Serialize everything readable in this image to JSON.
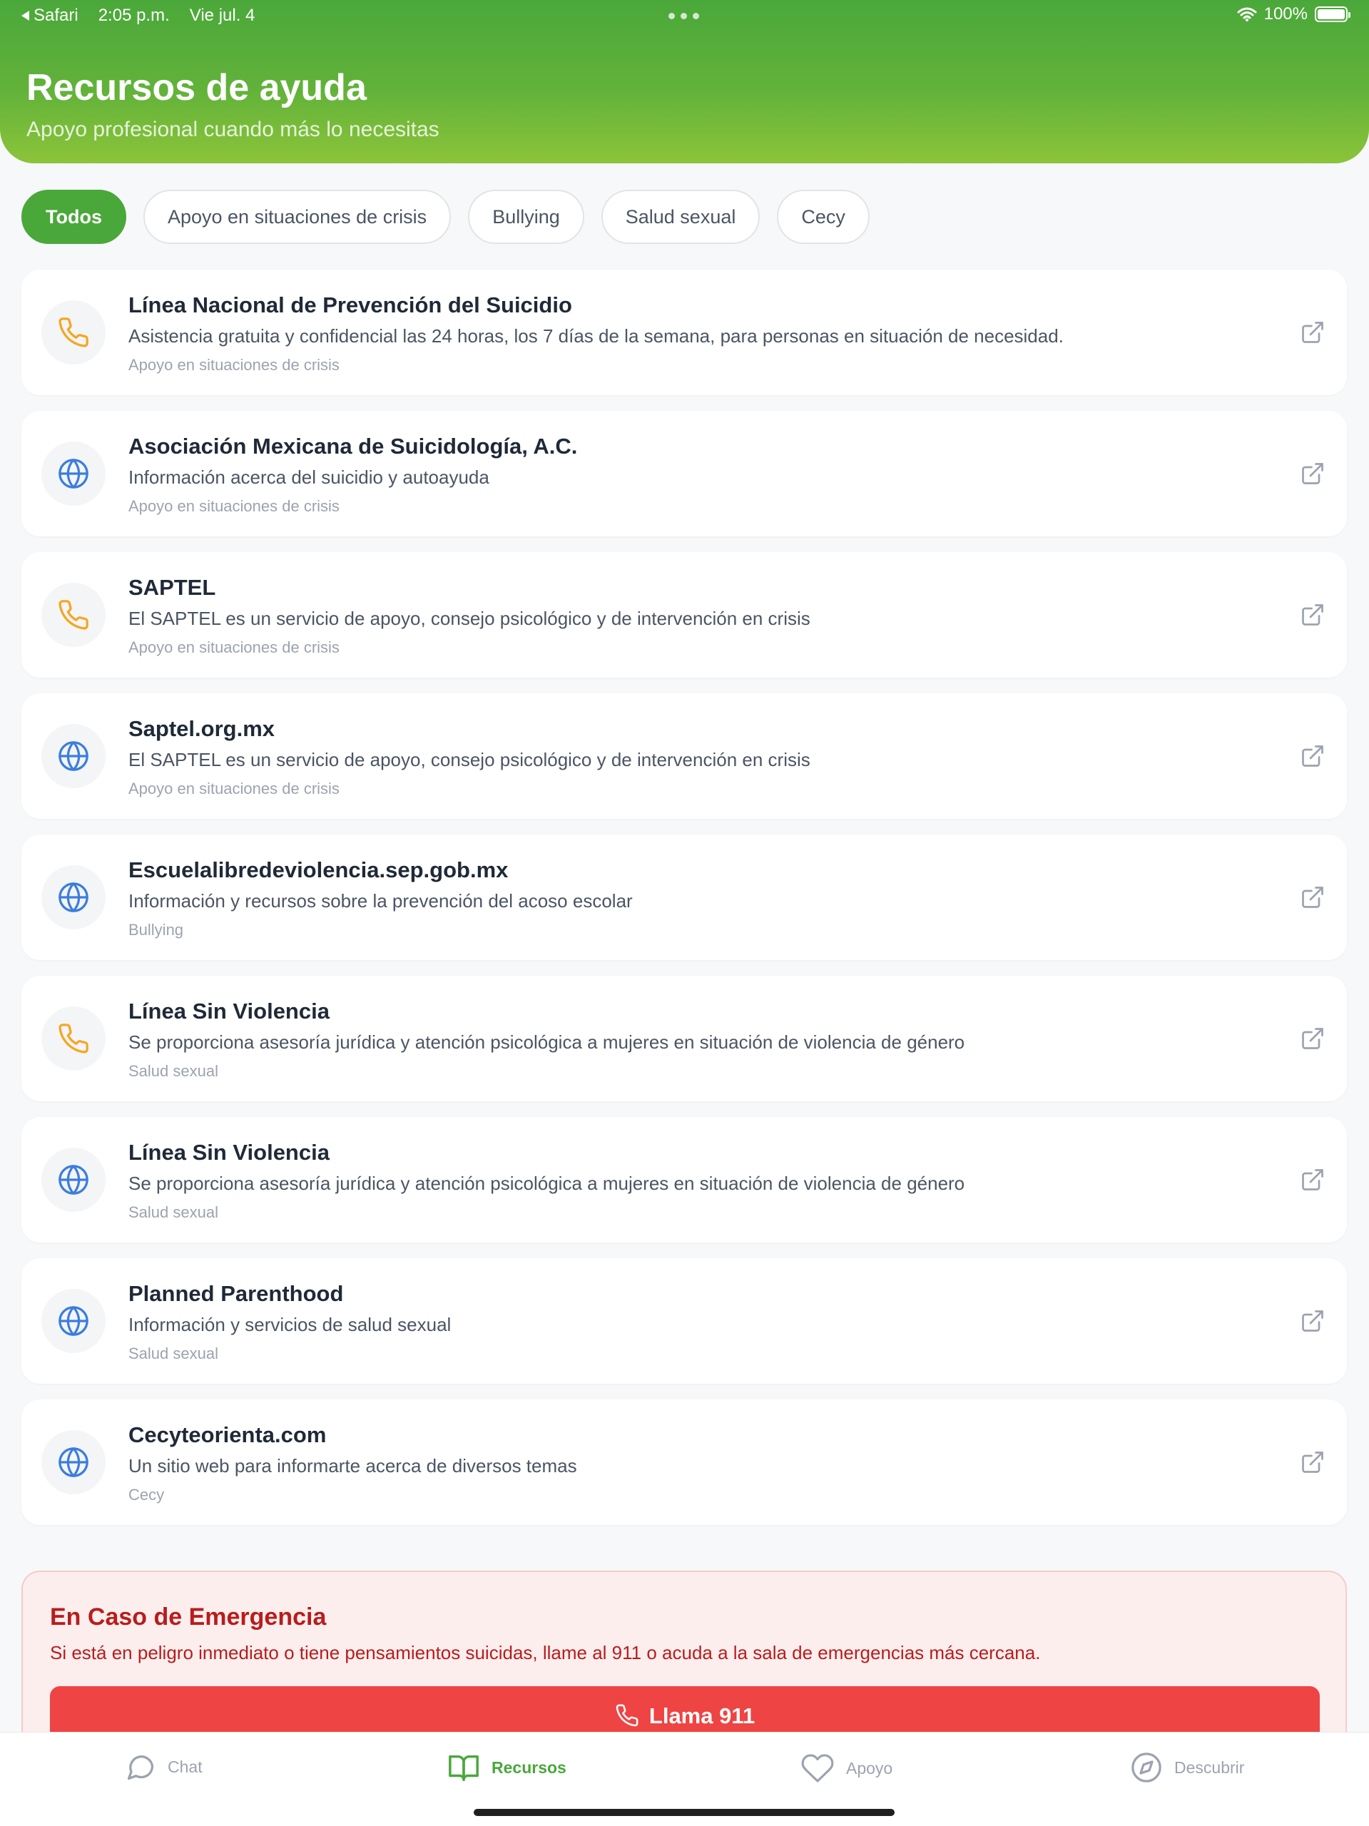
{
  "status_bar": {
    "back_app": "Safari",
    "time": "2:05 p.m.",
    "date": "Vie jul. 4",
    "battery": "100%"
  },
  "header": {
    "title": "Recursos de ayuda",
    "subtitle": "Apoyo profesional cuando más lo necesitas"
  },
  "filters": [
    {
      "label": "Todos",
      "active": true
    },
    {
      "label": "Apoyo en situaciones de crisis",
      "active": false
    },
    {
      "label": "Bullying",
      "active": false
    },
    {
      "label": "Salud sexual",
      "active": false
    },
    {
      "label": "Cecy",
      "active": false
    }
  ],
  "resources": [
    {
      "icon": "phone-icon",
      "name": "Línea Nacional de Prevención del Suicidio",
      "description": "Asistencia gratuita y confidencial las 24 horas, los 7 días de la semana, para personas en situación de necesidad.",
      "category": "Apoyo en situaciones de crisis"
    },
    {
      "icon": "globe-icon",
      "name": "Asociación Mexicana de Suicidología, A.C.",
      "description": "Información acerca del suicidio y autoayuda",
      "category": "Apoyo en situaciones de crisis"
    },
    {
      "icon": "phone-icon",
      "name": "SAPTEL",
      "description": "El SAPTEL es un servicio de apoyo, consejo psicológico y de intervención en crisis",
      "category": "Apoyo en situaciones de crisis"
    },
    {
      "icon": "globe-icon",
      "name": "Saptel.org.mx",
      "description": "El SAPTEL es un servicio de apoyo, consejo psicológico y de intervención en crisis",
      "category": "Apoyo en situaciones de crisis"
    },
    {
      "icon": "globe-icon",
      "name": "Escuelalibredeviolencia.sep.gob.mx",
      "description": "Información y recursos sobre la prevención del acoso escolar",
      "category": "Bullying"
    },
    {
      "icon": "phone-icon",
      "name": "Línea Sin Violencia",
      "description": "Se proporciona asesoría jurídica y atención psicológica a mujeres en situación de violencia de género",
      "category": "Salud sexual"
    },
    {
      "icon": "globe-icon",
      "name": "Línea Sin Violencia",
      "description": "Se proporciona asesoría jurídica y atención psicológica a mujeres en situación de violencia de género",
      "category": "Salud sexual"
    },
    {
      "icon": "globe-icon",
      "name": "Planned Parenthood",
      "description": "Información y servicios de salud sexual",
      "category": "Salud sexual"
    },
    {
      "icon": "globe-icon",
      "name": "Cecyteorienta.com",
      "description": "Un sitio web para informarte acerca de diversos temas",
      "category": "Cecy"
    }
  ],
  "emergency": {
    "title": "En Caso de Emergencia",
    "text": "Si está en peligro inmediato o tiene pensamientos suicidas, llame al 911 o acuda a la sala de emergencias más cercana.",
    "button_label": "Llama 911"
  },
  "tabbar": [
    {
      "label": "Chat",
      "icon": "chat-bubble-icon",
      "active": false
    },
    {
      "label": "Recursos",
      "icon": "book-icon",
      "active": true
    },
    {
      "label": "Apoyo",
      "icon": "heart-icon",
      "active": false
    },
    {
      "label": "Descubrir",
      "icon": "compass-icon",
      "active": false
    }
  ],
  "colors": {
    "brand_green": "#4aa83a",
    "phone_icon": "#f5a623",
    "globe_icon": "#3b7ddd",
    "emergency_red": "#ef4444"
  }
}
